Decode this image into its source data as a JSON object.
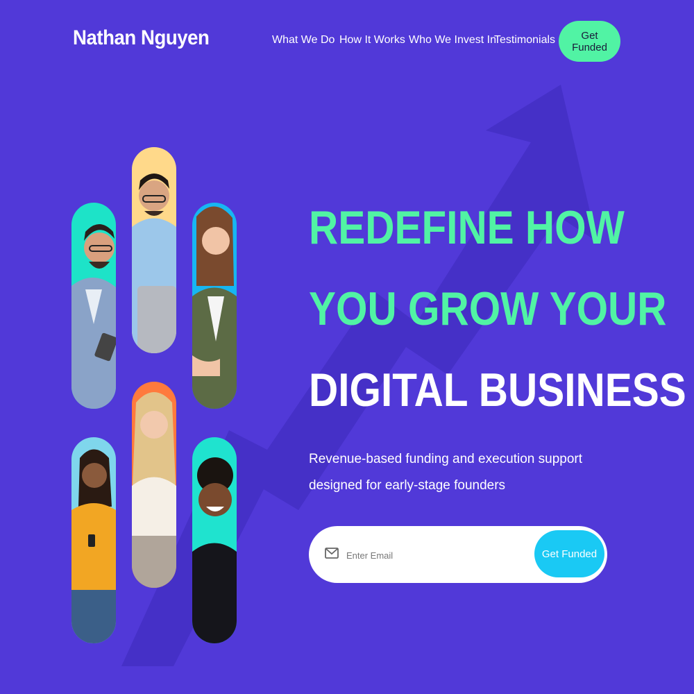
{
  "brand": {
    "name": "Nathan Nguyen"
  },
  "nav": {
    "items": [
      {
        "label": "What We Do"
      },
      {
        "label": "How It Works"
      },
      {
        "label": "Who We Invest In"
      },
      {
        "label": "Testimonials"
      }
    ],
    "cta_label": "Get Funded"
  },
  "hero": {
    "title_line1": "REDEFINE HOW",
    "title_line2": "YOU GROW YOUR",
    "title_line3": "DIGITAL BUSINESS",
    "subtitle": "Revenue-based funding and execution support designed for early-stage founders"
  },
  "signup": {
    "email_placeholder": "Enter Email",
    "cta_label": "Get Funded"
  },
  "gallery": {
    "photos": [
      {
        "kind": "man-glasses-tablet",
        "bg": "#1de3c8"
      },
      {
        "kind": "man-glasses-laptop",
        "bg": "#ffd98a"
      },
      {
        "kind": "woman-olive-jacket",
        "bg": "#17b6f2"
      },
      {
        "kind": "woman-yellow-sweater-phone",
        "bg": "#7fd6ec"
      },
      {
        "kind": "woman-blonde-laptop",
        "bg": "#ff7a3d"
      },
      {
        "kind": "man-smiling-black-shirt",
        "bg": "#1fe3cf"
      }
    ]
  },
  "colors": {
    "background": "#5139d8",
    "accent_green": "#51f3a4",
    "accent_cyan": "#1ac9f4",
    "arrow": "#4530c7"
  }
}
